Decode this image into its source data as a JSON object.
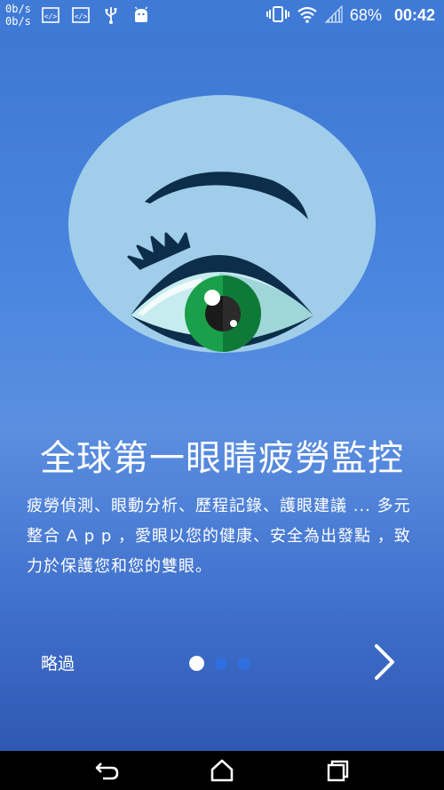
{
  "status_bar": {
    "net_speed_up": "0b/s",
    "net_speed_down": "0b/s",
    "notification_icons": [
      "code-icon",
      "code-icon",
      "usb-icon",
      "android-icon"
    ],
    "system_icons": [
      "vibrate-icon",
      "wifi-icon",
      "signal-icon"
    ],
    "battery_percent": "68%",
    "time": "00:42"
  },
  "onboarding": {
    "illustration": "eye-illustration",
    "headline": "全球第一眼睛疲勞監控",
    "description": "疲勞偵測、眼動分析、歷程記錄、護眼建議 ... 多元整合 A p p ，愛眼以您的健康、安全為出發點 ，致力於保護您和您的雙眼。",
    "skip_label": "略過",
    "page_count": 3,
    "current_page": 1,
    "next_icon": "chevron-right-icon"
  },
  "nav_bar": {
    "back_icon": "back-icon",
    "home_icon": "home-icon",
    "recents_icon": "recents-icon"
  },
  "colors": {
    "background_top": "#3e78d4",
    "background_bottom": "#2f58b2",
    "circle": "#a0cdea",
    "iris": "#1aa04a",
    "dot_inactive": "#2f6fe0"
  }
}
